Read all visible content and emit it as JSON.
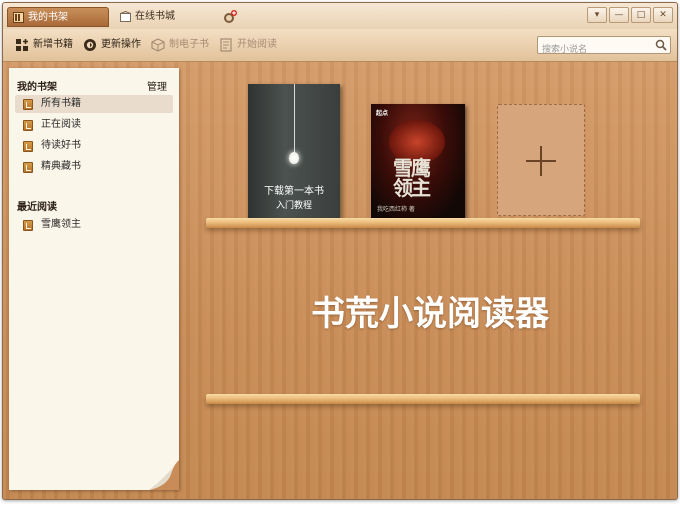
{
  "tabs": [
    {
      "label": "我的书架",
      "active": true
    },
    {
      "label": "在线书城",
      "active": false
    }
  ],
  "window_controls": [
    "▾",
    "—",
    "□",
    "✕"
  ],
  "toolbar": {
    "buttons": [
      {
        "label": "新增书籍",
        "enabled": true,
        "icon": "add-book-icon"
      },
      {
        "label": "更新操作",
        "enabled": true,
        "icon": "update-icon"
      },
      {
        "label": "制电子书",
        "enabled": false,
        "icon": "make-ebook-icon"
      },
      {
        "label": "开始阅读",
        "enabled": false,
        "icon": "start-reading-icon"
      }
    ],
    "search_placeholder": "搜索小说名"
  },
  "sidebar": {
    "my_shelf_title": "我的书架",
    "manage_label": "管理",
    "items": [
      {
        "label": "所有书籍",
        "selected": true
      },
      {
        "label": "正在阅读",
        "selected": false
      },
      {
        "label": "待读好书",
        "selected": false
      },
      {
        "label": "精典藏书",
        "selected": false
      }
    ],
    "recent_title": "最近阅读",
    "recent_items": [
      {
        "label": "雪鹰领主"
      }
    ]
  },
  "books": [
    {
      "line1": "下载第一本书",
      "line2": "入门教程"
    },
    {
      "logo": "起点",
      "title": "雪鹰领主",
      "author": "我吃西红柿 著"
    }
  ],
  "add_book": "+",
  "watermark": "书荒小说阅读器",
  "colors": {
    "wood": "#c98c58",
    "paper": "#fbf6ea",
    "shelf": "#e8b978",
    "active_tab": "#a86a38"
  }
}
